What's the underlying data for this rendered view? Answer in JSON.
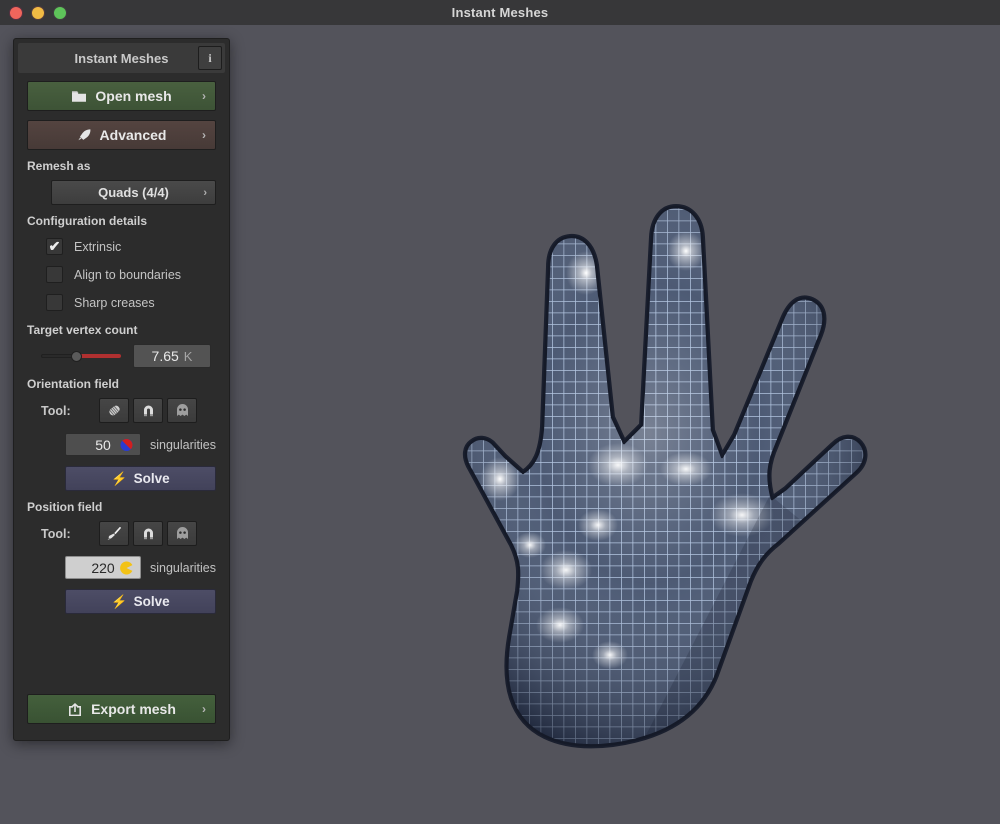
{
  "window": {
    "title": "Instant Meshes",
    "traffic_lights": [
      {
        "name": "close",
        "color": "#f0655c"
      },
      {
        "name": "minimize",
        "color": "#f2bb44"
      },
      {
        "name": "zoom",
        "color": "#5ec45a"
      }
    ]
  },
  "panel": {
    "title": "Instant Meshes",
    "info_button_label": "i",
    "open_mesh": {
      "label": "Open mesh",
      "icon": "folder-icon",
      "chevron": "›",
      "color": "#49603f"
    },
    "advanced": {
      "label": "Advanced",
      "icon": "rocket-icon",
      "chevron": "›",
      "color": "#544440"
    },
    "remesh": {
      "section_label": "Remesh as",
      "value": "Quads (4/4)",
      "chevron": "›"
    },
    "configuration": {
      "section_label": "Configuration details",
      "options": [
        {
          "label": "Extrinsic",
          "checked": true,
          "check_glyph": "✔"
        },
        {
          "label": "Align to boundaries",
          "checked": false,
          "check_glyph": ""
        },
        {
          "label": "Sharp creases",
          "checked": false,
          "check_glyph": ""
        }
      ]
    },
    "target_vertex_count": {
      "section_label": "Target vertex count",
      "value": "7.65",
      "unit": "K",
      "slider_percent": 38,
      "slider_fill_color": "#b03030"
    },
    "orientation_field": {
      "section_label": "Orientation field",
      "tool_label": "Tool:",
      "tools": [
        {
          "name": "comb-icon",
          "selected": false
        },
        {
          "name": "magnet-icon",
          "selected": false
        },
        {
          "name": "ghost-eraser-icon",
          "selected": false
        }
      ],
      "singularities_value": "50",
      "singularities_label": "singularities",
      "badge": "orientation-singularity-icon",
      "solve_label": "Solve",
      "solve_icon": "⚡"
    },
    "position_field": {
      "section_label": "Position field",
      "tool_label": "Tool:",
      "tools": [
        {
          "name": "brush-icon",
          "selected": true
        },
        {
          "name": "magnet-icon",
          "selected": false
        },
        {
          "name": "ghost-eraser-icon",
          "selected": false
        }
      ],
      "singularities_value": "220",
      "singularities_label": "singularities",
      "badge": "position-singularity-icon",
      "solve_label": "Solve",
      "solve_icon": "⚡"
    },
    "export_mesh": {
      "label": "Export mesh",
      "icon": "export-icon",
      "chevron": "›",
      "color": "#44603c"
    }
  },
  "viewport": {
    "background_color": "#53535b",
    "model_name": "hand-mesh",
    "mesh_surface_color": "#4a5a76",
    "wireframe_color": "#b8cbe8"
  }
}
